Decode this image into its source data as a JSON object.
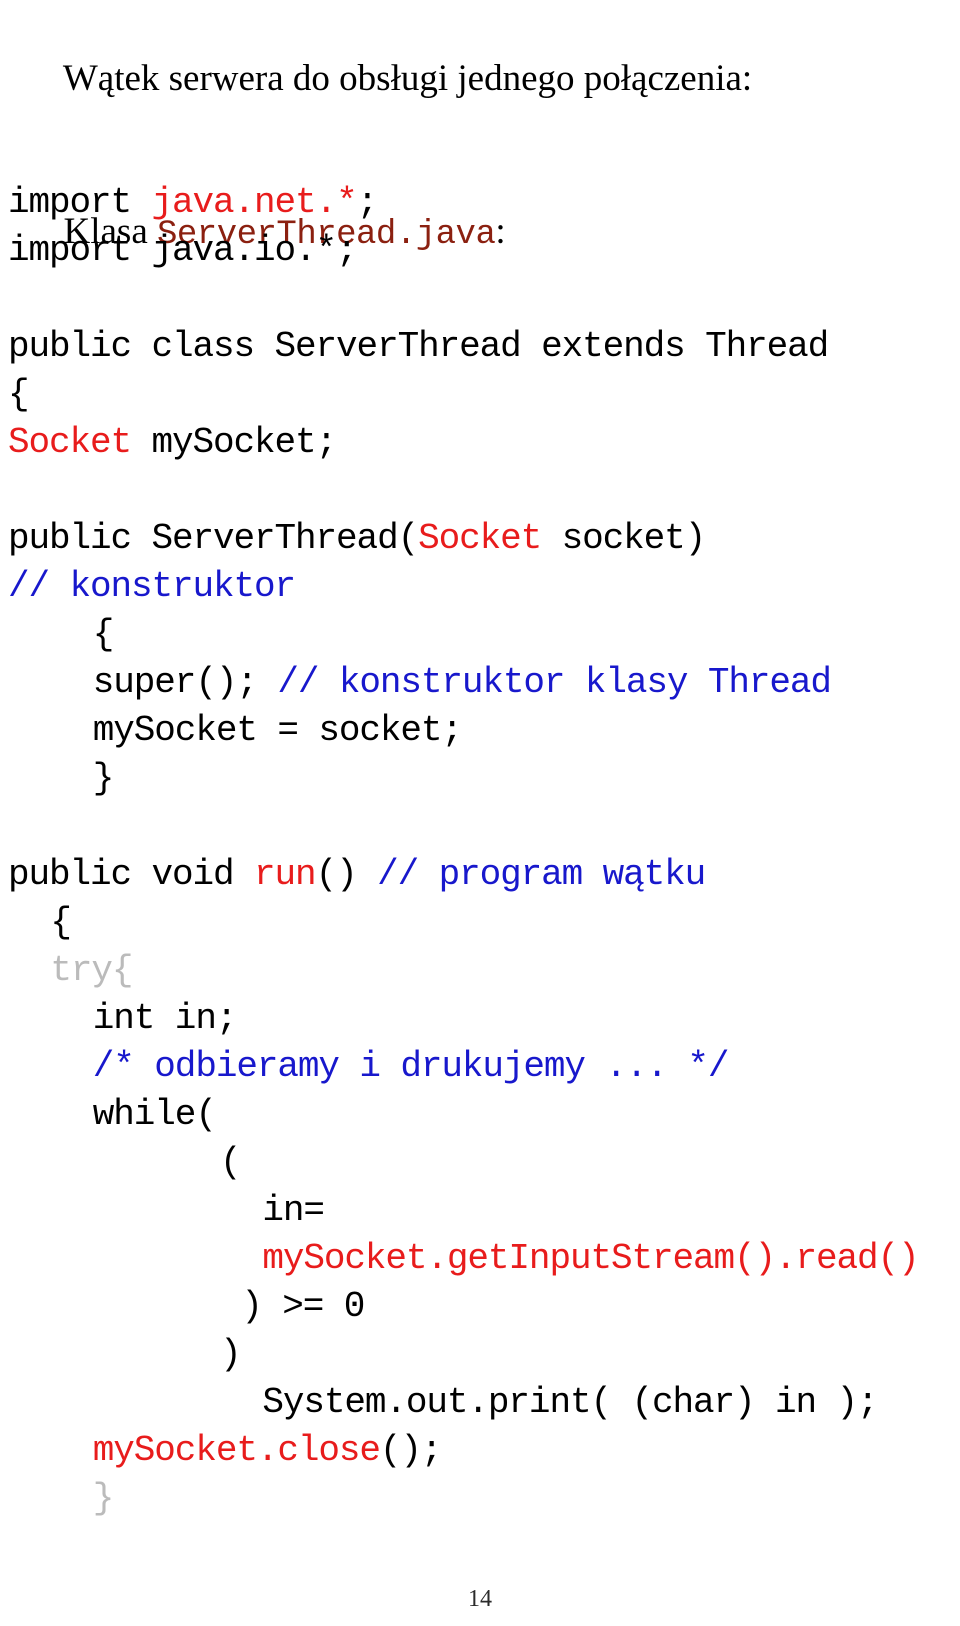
{
  "slide": {
    "page_number": "14",
    "colors": {
      "text": "#000000",
      "keyword_red": "#E81C1C",
      "comment_blue": "#1818CC",
      "muted_gray": "#BBBBBB",
      "title_dark_red": "#8B2010",
      "background": "#FFFFFF"
    }
  },
  "heading": {
    "line1": "Wątek serwera do obsługi jednego połączenia:",
    "line2_prefix": "Klasa ",
    "line2_filename": "ServerThread.java",
    "line2_suffix": ":"
  },
  "code": {
    "language": "java",
    "lines": [
      {
        "indent": 0,
        "tokens": []
      },
      {
        "indent": 0,
        "tokens": [
          {
            "text": "import ",
            "color": "black"
          },
          {
            "text": "java.net.*",
            "color": "red"
          },
          {
            "text": ";",
            "color": "black"
          }
        ]
      },
      {
        "indent": 0,
        "tokens": [
          {
            "text": "import java.io.*;",
            "color": "black"
          }
        ]
      },
      {
        "indent": 0,
        "tokens": []
      },
      {
        "indent": 0,
        "tokens": [
          {
            "text": "public class ServerThread extends Thread",
            "color": "black"
          }
        ]
      },
      {
        "indent": 0,
        "tokens": [
          {
            "text": "{",
            "color": "black"
          }
        ]
      },
      {
        "indent": 0,
        "tokens": [
          {
            "text": "Socket",
            "color": "red"
          },
          {
            "text": " mySocket;",
            "color": "black"
          }
        ]
      },
      {
        "indent": 0,
        "tokens": []
      },
      {
        "indent": 0,
        "tokens": [
          {
            "text": "public ServerThread(",
            "color": "black"
          },
          {
            "text": "Socket",
            "color": "red"
          },
          {
            "text": " socket)",
            "color": "black"
          }
        ]
      },
      {
        "indent": 0,
        "tokens": [
          {
            "text": "// konstruktor",
            "color": "blue"
          }
        ]
      },
      {
        "indent": 4,
        "tokens": [
          {
            "text": "{",
            "color": "black"
          }
        ]
      },
      {
        "indent": 4,
        "tokens": [
          {
            "text": "super(); ",
            "color": "black"
          },
          {
            "text": "// konstruktor klasy Thread",
            "color": "blue"
          }
        ]
      },
      {
        "indent": 4,
        "tokens": [
          {
            "text": "mySocket = socket;",
            "color": "black"
          }
        ]
      },
      {
        "indent": 4,
        "tokens": [
          {
            "text": "}",
            "color": "black"
          }
        ]
      },
      {
        "indent": 0,
        "tokens": []
      },
      {
        "indent": 0,
        "tokens": [
          {
            "text": "public void ",
            "color": "black"
          },
          {
            "text": "run",
            "color": "red"
          },
          {
            "text": "() ",
            "color": "black"
          },
          {
            "text": "// program wątku",
            "color": "blue"
          }
        ]
      },
      {
        "indent": 2,
        "tokens": [
          {
            "text": "{",
            "color": "black"
          }
        ]
      },
      {
        "indent": 2,
        "tokens": [
          {
            "text": "try{",
            "color": "gray"
          }
        ]
      },
      {
        "indent": 4,
        "tokens": [
          {
            "text": "int in;",
            "color": "black"
          }
        ]
      },
      {
        "indent": 4,
        "tokens": [
          {
            "text": "/* odbieramy i drukujemy ... */",
            "color": "blue"
          }
        ]
      },
      {
        "indent": 4,
        "tokens": [
          {
            "text": "while(",
            "color": "black"
          }
        ]
      },
      {
        "indent": 10,
        "tokens": [
          {
            "text": "(",
            "color": "black"
          }
        ]
      },
      {
        "indent": 12,
        "tokens": [
          {
            "text": "in=",
            "color": "black"
          }
        ]
      },
      {
        "indent": 12,
        "tokens": [
          {
            "text": "mySocket.getInputStream().read()",
            "color": "red"
          }
        ]
      },
      {
        "indent": 11,
        "tokens": [
          {
            "text": ") >= 0",
            "color": "black"
          }
        ]
      },
      {
        "indent": 10,
        "tokens": [
          {
            "text": ")",
            "color": "black"
          }
        ]
      },
      {
        "indent": 12,
        "tokens": [
          {
            "text": "System.out.print( (char) in );",
            "color": "black"
          }
        ]
      },
      {
        "indent": 4,
        "tokens": [
          {
            "text": "mySocket.close",
            "color": "red"
          },
          {
            "text": "();",
            "color": "black"
          }
        ]
      },
      {
        "indent": 4,
        "tokens": [
          {
            "text": "}",
            "color": "gray"
          }
        ]
      }
    ]
  }
}
